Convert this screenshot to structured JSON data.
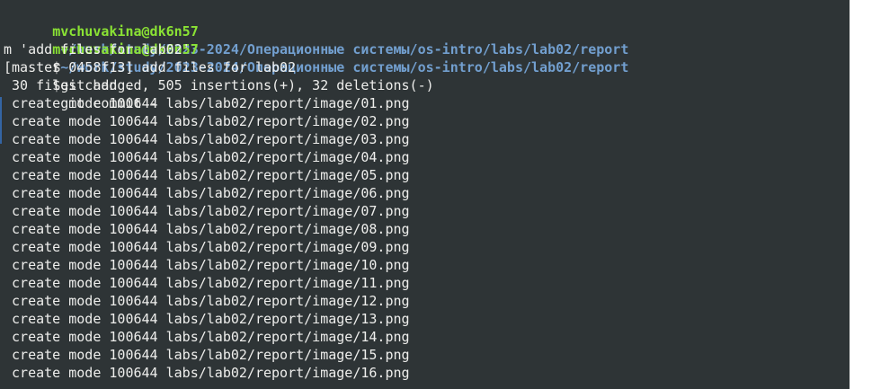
{
  "prompt": {
    "user_host": "mvchuvakina@dk6n57",
    "path": "~/work/study/2023-2024/Операционные системы/os-intro/labs/lab02/report",
    "symbol": "$"
  },
  "commands": {
    "add": " git add .",
    "commit_part1": " git commit -",
    "commit_part2": "m 'add files for lab02'"
  },
  "output": {
    "commit_header": "[master 0458f13] add files for lab02",
    "summary": " 30 files changed, 505 insertions(+), 32 deletions(-)",
    "created_files": [
      " create mode 100644 labs/lab02/report/image/01.png",
      " create mode 100644 labs/lab02/report/image/02.png",
      " create mode 100644 labs/lab02/report/image/03.png",
      " create mode 100644 labs/lab02/report/image/04.png",
      " create mode 100644 labs/lab02/report/image/05.png",
      " create mode 100644 labs/lab02/report/image/06.png",
      " create mode 100644 labs/lab02/report/image/07.png",
      " create mode 100644 labs/lab02/report/image/08.png",
      " create mode 100644 labs/lab02/report/image/09.png",
      " create mode 100644 labs/lab02/report/image/10.png",
      " create mode 100644 labs/lab02/report/image/11.png",
      " create mode 100644 labs/lab02/report/image/12.png",
      " create mode 100644 labs/lab02/report/image/13.png",
      " create mode 100644 labs/lab02/report/image/14.png",
      " create mode 100644 labs/lab02/report/image/15.png",
      " create mode 100644 labs/lab02/report/image/16.png"
    ]
  },
  "colors": {
    "background": "#2e3436",
    "foreground": "#eeeeec",
    "user_host": "#8ae234",
    "path": "#729fcf",
    "scrollbar": "#ffffff"
  }
}
